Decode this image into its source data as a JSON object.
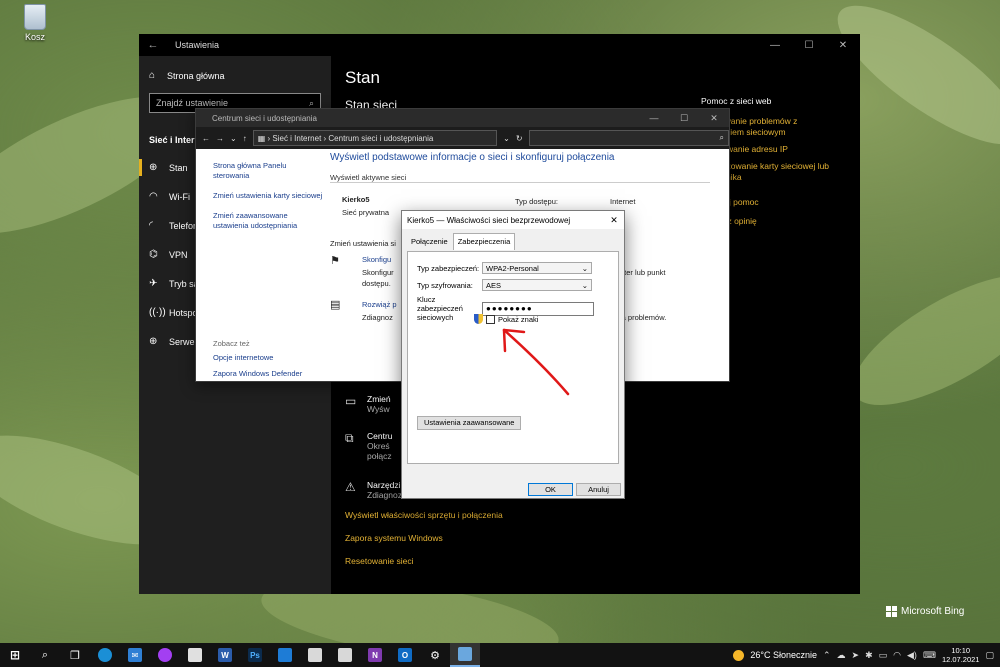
{
  "desktop": {
    "recycle_bin_label": "Kosz"
  },
  "settings": {
    "window_title": "Ustawienia",
    "home_label": "Strona główna",
    "search_placeholder": "Znajdź ustawienie",
    "section_label": "Sieć i Internet",
    "nav": [
      {
        "label": "Stan",
        "icon": "globe-icon",
        "active": true
      },
      {
        "label": "Wi-Fi",
        "icon": "wifi-icon"
      },
      {
        "label": "Telefon",
        "icon": "cellular-icon"
      },
      {
        "label": "VPN",
        "icon": "vpn-icon"
      },
      {
        "label": "Tryb sam",
        "icon": "airplane-icon"
      },
      {
        "label": "Hotspo",
        "icon": "hotspot-icon"
      },
      {
        "label": "Serwer",
        "icon": "proxy-icon"
      }
    ],
    "page_title": "Stan",
    "page_subtitle": "Stan sieci",
    "help_title": "Pomoc z sieci web",
    "help_links": [
      "centrowanie problemów z\nołączeniem sieciowym",
      "Znajdowanie adresu IP",
      "Aktualizowanie karty sieciowej lub\nsterownika",
      "Uzyskaj pomoc",
      "Przekaż opinię"
    ],
    "rows": [
      {
        "title": "Zmień",
        "desc": "Wyśw"
      },
      {
        "title": "Centru",
        "desc": "Okreś\npołącz"
      },
      {
        "title": "Narzędzi",
        "desc": "Zdiagnoz"
      }
    ],
    "links": [
      "Wyświetl właściwości sprzętu i połączenia",
      "Zapora systemu Windows",
      "Resetowanie sieci"
    ]
  },
  "control_panel": {
    "window_title": "Centrum sieci i udostępniania",
    "breadcrumb": [
      "Sieć i Internet",
      "Centrum sieci i udostępniania"
    ],
    "left_links": [
      "Strona główna Panelu sterowania",
      "Zmień ustawienia karty sieciowej",
      "Zmień zaawansowane ustawienia udostępniania"
    ],
    "see_also_title": "Zobacz też",
    "see_also": [
      "Opcje internetowe",
      "Zapora Windows Defender"
    ],
    "heading": "Wyświetl podstawowe informacje o sieci i skonfiguruj połączenia",
    "active_networks_label": "Wyświetl aktywne sieci",
    "network_name": "Kierko5",
    "network_type": "Sieć prywatna",
    "access_type_label": "Typ dostępu:",
    "access_type_value": "Internet",
    "change_settings_label": "Zmień ustawienia si",
    "setup_title": "Skonfigu",
    "setup_desc": "Skonfigur",
    "setup_desc2": "dostępu.",
    "router_text": "uter lub punkt",
    "troubleshoot_title": "Rozwiąż p",
    "troubleshoot_desc": "Zdiagnoz",
    "problems_text": "ia problemów."
  },
  "dialog": {
    "title": "Kierko5 — Właściwości sieci bezprzewodowej",
    "tabs": [
      "Połączenie",
      "Zabezpieczenia"
    ],
    "active_tab": "Zabezpieczenia",
    "security_type_label": "Typ zabezpieczeń:",
    "security_type_value": "WPA2-Personal",
    "encryption_label": "Typ szyfrowania:",
    "encryption_value": "AES",
    "key_label": "Klucz zabezpieczeń sieciowych",
    "key_value": "●●●●●●●●",
    "show_chars_label": "Pokaż znaki",
    "advanced_button": "Ustawienia zaawansowane",
    "ok_button": "OK",
    "cancel_button": "Anuluj"
  },
  "watermark": "Microsoft Bing",
  "taskbar": {
    "weather": "26°C  Słonecznie",
    "time": "10:10",
    "date": "12.07.2021"
  }
}
